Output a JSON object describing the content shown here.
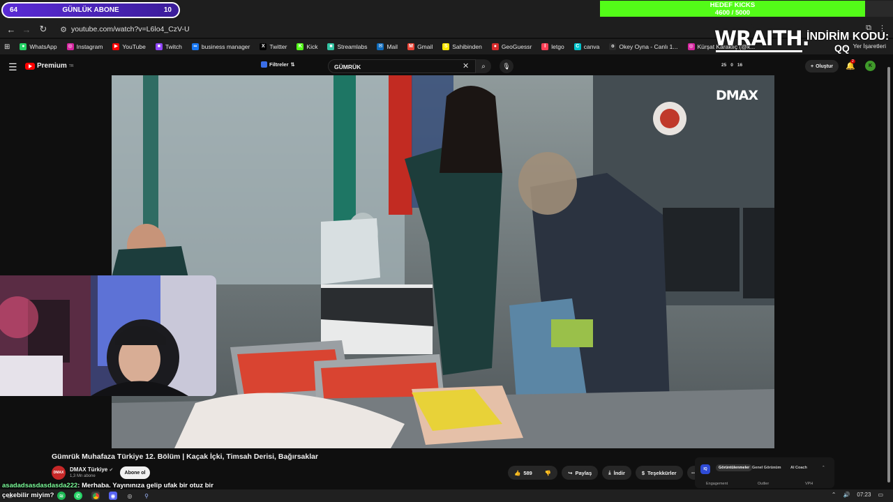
{
  "overlays": {
    "sub_goal": {
      "left_value": "64",
      "label": "GÜNLÜK ABONE",
      "right_value": "10"
    },
    "kick_goal": {
      "title": "HEDEF KICKS",
      "progress": "4600 / 5000"
    },
    "sponsor": {
      "brand": "WRAITH.",
      "discount_label": "İNDİRİM KODU:",
      "discount_code": "QQ"
    }
  },
  "browser": {
    "url": "youtube.com/watch?v=L6lo4_CzV-U",
    "bookmarks": [
      {
        "label": "WhatsApp",
        "color": "#25d366",
        "glyph": "●"
      },
      {
        "label": "Instagram",
        "color": "#d6249f",
        "glyph": "◎"
      },
      {
        "label": "YouTube",
        "color": "#ff0000",
        "glyph": "▶"
      },
      {
        "label": "Twitch",
        "color": "#9146ff",
        "glyph": "■"
      },
      {
        "label": "business manager",
        "color": "#1877f2",
        "glyph": "∞"
      },
      {
        "label": "Twitter",
        "color": "#000000",
        "glyph": "X"
      },
      {
        "label": "Kick",
        "color": "#53fc18",
        "glyph": "K"
      },
      {
        "label": "Streamlabs",
        "color": "#31c3a2",
        "glyph": "■"
      },
      {
        "label": "Mail",
        "color": "#0f6cbd",
        "glyph": "✉"
      },
      {
        "label": "Gmail",
        "color": "#ea4335",
        "glyph": "M"
      },
      {
        "label": "Sahibinden",
        "color": "#ffe800",
        "glyph": "S"
      },
      {
        "label": "GeoGuessr",
        "color": "#d82b2b",
        "glyph": "●"
      },
      {
        "label": "letgo",
        "color": "#ff3f55",
        "glyph": "l"
      },
      {
        "label": "canva",
        "color": "#00c4cc",
        "glyph": "C"
      },
      {
        "label": "Okey Oyna - Canlı 1...",
        "color": "#2a2a2a",
        "glyph": "o"
      },
      {
        "label": "Kürşat Karaklıç (@k...",
        "color": "#d6249f",
        "glyph": "◎"
      }
    ],
    "bookmarks_right": "Yer İşaretleri"
  },
  "youtube": {
    "brand": "Premium",
    "region": "TR",
    "filters_label": "Filtreler",
    "search_value": "GÜMRÜK",
    "stats": [
      "25",
      "0",
      "16"
    ],
    "create_label": "Oluştur",
    "notification_count": "2",
    "avatar_letter": "K",
    "video_watermark": "DMAX",
    "video_title": "Gümrük Muhafaza Türkiye 12. Bölüm | Kaçak İçki, Timsah Derisi, Bağırsaklar",
    "channel": {
      "name": "DMAX Türkiye",
      "subs": "1,3 Mn abone",
      "avatar_text": "DMAX"
    },
    "subscribe_label": "Abone ol",
    "like_count": "589",
    "share_label": "Paylaş",
    "download_label": "İndir",
    "thanks_label": "Teşekkürler",
    "more_label": "⋯"
  },
  "analytics_panel": {
    "logo": "IQ",
    "tabs": [
      "Görüntülenmeler",
      "Genel Görünüm",
      "AI Coach"
    ],
    "columns": [
      "Engagement",
      "Outlier",
      "VPH"
    ]
  },
  "chat": {
    "user": "asadadsasdasdasda222",
    "message": ": Merhaba. Yayınınıza gelip ufak bir otuz bir çekebilir miyim?"
  },
  "taskbar": {
    "time": "07:23"
  }
}
